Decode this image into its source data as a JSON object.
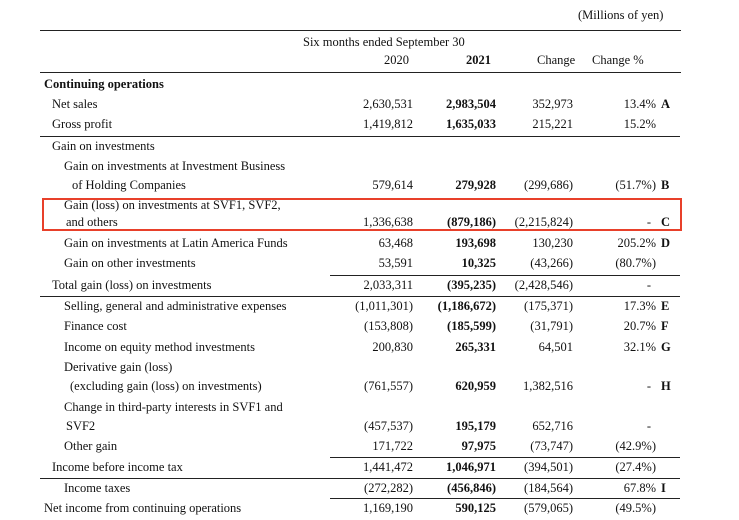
{
  "unit_label": "(Millions of yen)",
  "header": {
    "period": "Six months ended September 30",
    "col_2020": "2020",
    "col_2021": "2021",
    "col_change": "Change",
    "col_change_pct": "Change %"
  },
  "section_title": "Continuing operations",
  "rows": [
    {
      "label": "Net sales",
      "v2020": "2,630,531",
      "v2021": "2,983,504",
      "change": "352,973",
      "pct": "13.4%",
      "note": "A"
    },
    {
      "label": "Gross profit",
      "v2020": "1,419,812",
      "v2021": "1,635,033",
      "change": "215,221",
      "pct": "15.2%",
      "note": ""
    },
    {
      "label": "Gain on investments"
    },
    {
      "label1": "Gain on investments at Investment Business",
      "label2": "of Holding Companies",
      "v2020": "579,614",
      "v2021": "279,928",
      "change": "(299,686)",
      "pct": "(51.7%)",
      "note": "B"
    },
    {
      "label1": "Gain (loss) on investments at SVF1, SVF2,",
      "label2": "and others",
      "v2020": "1,336,638",
      "v2021": "(879,186)",
      "change": "(2,215,824)",
      "pct": "-",
      "note": "C"
    },
    {
      "label": "Gain on investments at Latin America Funds",
      "v2020": "63,468",
      "v2021": "193,698",
      "change": "130,230",
      "pct": "205.2%",
      "note": "D"
    },
    {
      "label": "Gain on other investments",
      "v2020": "53,591",
      "v2021": "10,325",
      "change": "(43,266)",
      "pct": "(80.7%)",
      "note": ""
    },
    {
      "label": "Total gain (loss) on investments",
      "v2020": "2,033,311",
      "v2021": "(395,235)",
      "change": "(2,428,546)",
      "pct": "-",
      "note": ""
    },
    {
      "label": "Selling, general and administrative expenses",
      "v2020": "(1,011,301)",
      "v2021": "(1,186,672)",
      "change": "(175,371)",
      "pct": "17.3%",
      "note": "E"
    },
    {
      "label": "Finance cost",
      "v2020": "(153,808)",
      "v2021": "(185,599)",
      "change": "(31,791)",
      "pct": "20.7%",
      "note": "F"
    },
    {
      "label": "Income on equity method investments",
      "v2020": "200,830",
      "v2021": "265,331",
      "change": "64,501",
      "pct": "32.1%",
      "note": "G"
    },
    {
      "label1": "Derivative gain (loss)",
      "label2": "(excluding gain (loss) on investments)",
      "v2020": "(761,557)",
      "v2021": "620,959",
      "change": "1,382,516",
      "pct": "-",
      "note": "H"
    },
    {
      "label1": "Change in third-party interests in SVF1 and",
      "label2": "SVF2",
      "v2020": "(457,537)",
      "v2021": "195,179",
      "change": "652,716",
      "pct": "-",
      "note": ""
    },
    {
      "label": "Other gain",
      "v2020": "171,722",
      "v2021": "97,975",
      "change": "(73,747)",
      "pct": "(42.9%)",
      "note": ""
    },
    {
      "label": "Income before income tax",
      "v2020": "1,441,472",
      "v2021": "1,046,971",
      "change": "(394,501)",
      "pct": "(27.4%)",
      "note": ""
    },
    {
      "label": "Income taxes",
      "v2020": "(272,282)",
      "v2021": "(456,846)",
      "change": "(184,564)",
      "pct": "67.8%",
      "note": "I"
    },
    {
      "label": "Net income from continuing operations",
      "v2020": "1,169,190",
      "v2021": "590,125",
      "change": "(579,065)",
      "pct": "(49.5%)",
      "note": ""
    }
  ]
}
